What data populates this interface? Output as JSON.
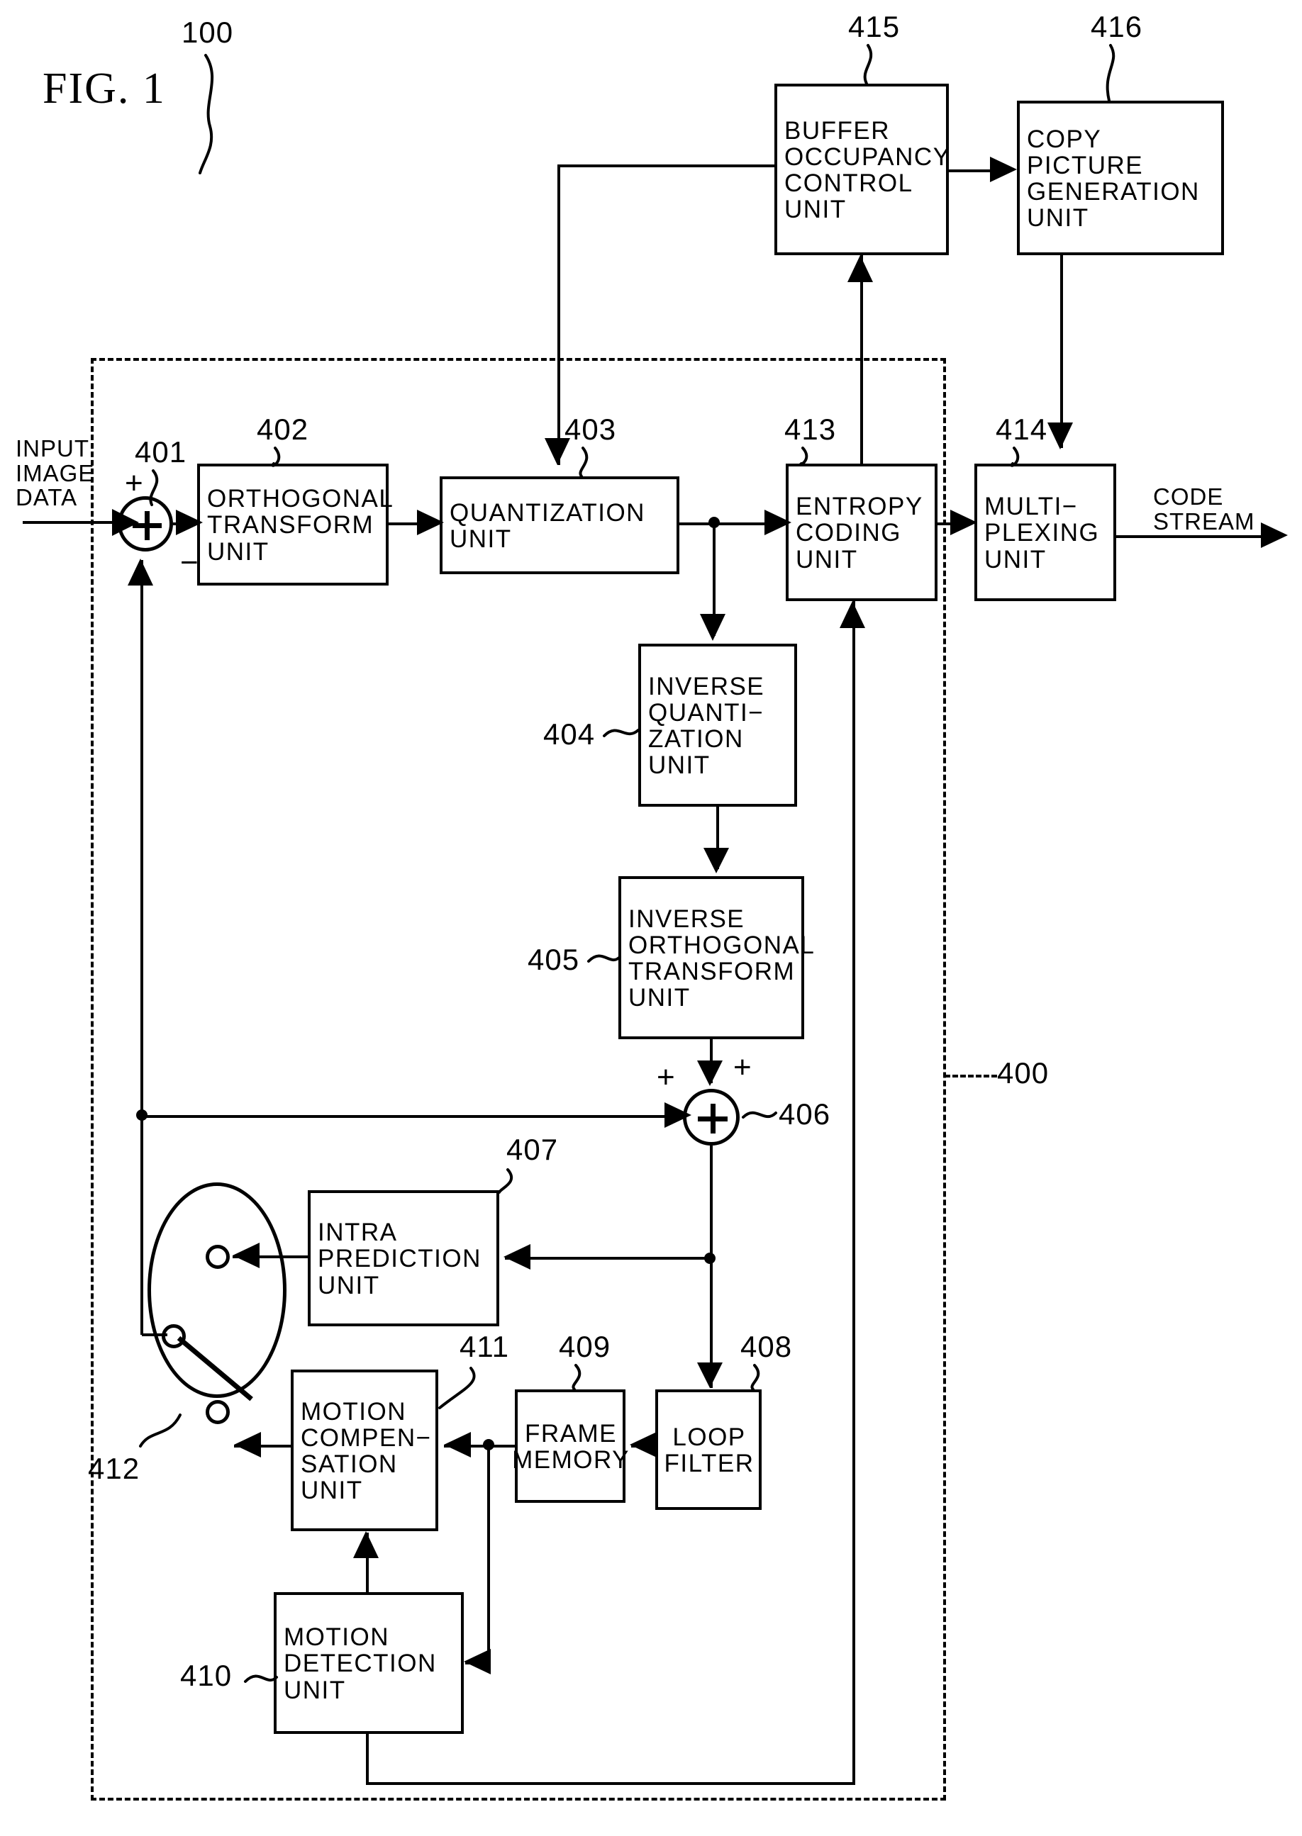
{
  "figure": {
    "title": "FIG. 1",
    "system_numeral": "100",
    "encoder_numeral": "400"
  },
  "flow_labels": {
    "input": "INPUT\nIMAGE\nDATA",
    "output": "CODE\nSTREAM"
  },
  "signs": {
    "adder401_plus": "+",
    "adder401_minus": "−",
    "adder406_plus_top": "+",
    "adder406_plus_left": "+"
  },
  "blocks": [
    {
      "id": "401",
      "numeral": "401",
      "label": "",
      "kind": "adder"
    },
    {
      "id": "402",
      "numeral": "402",
      "label": "ORTHOGONAL\nTRANSFORM\nUNIT"
    },
    {
      "id": "403",
      "numeral": "403",
      "label": "QUANTIZATION\nUNIT"
    },
    {
      "id": "404",
      "numeral": "404",
      "label": "INVERSE\nQUANTI−\nZATION\nUNIT"
    },
    {
      "id": "405",
      "numeral": "405",
      "label": "INVERSE\nORTHOGONAL\nTRANSFORM\nUNIT"
    },
    {
      "id": "406",
      "numeral": "406",
      "label": "",
      "kind": "adder"
    },
    {
      "id": "407",
      "numeral": "407",
      "label": "INTRA\nPREDICTION\nUNIT"
    },
    {
      "id": "408",
      "numeral": "408",
      "label": "LOOP\nFILTER"
    },
    {
      "id": "409",
      "numeral": "409",
      "label": "FRAME\nMEMORY"
    },
    {
      "id": "410",
      "numeral": "410",
      "label": "MOTION\nDETECTION\nUNIT"
    },
    {
      "id": "411",
      "numeral": "411",
      "label": "MOTION\nCOMPEN−\nSATION\nUNIT"
    },
    {
      "id": "412",
      "numeral": "412",
      "label": "",
      "kind": "switch"
    },
    {
      "id": "413",
      "numeral": "413",
      "label": "ENTROPY\nCODING\nUNIT"
    },
    {
      "id": "414",
      "numeral": "414",
      "label": "MULTI−\nPLEXING\nUNIT"
    },
    {
      "id": "415",
      "numeral": "415",
      "label": "BUFFER\nOCCUPANCY\nCONTROL\nUNIT"
    },
    {
      "id": "416",
      "numeral": "416",
      "label": "COPY PICTURE\nGENERATION\nUNIT"
    }
  ],
  "colors": {
    "ink": "#000000",
    "paper": "#ffffff"
  }
}
